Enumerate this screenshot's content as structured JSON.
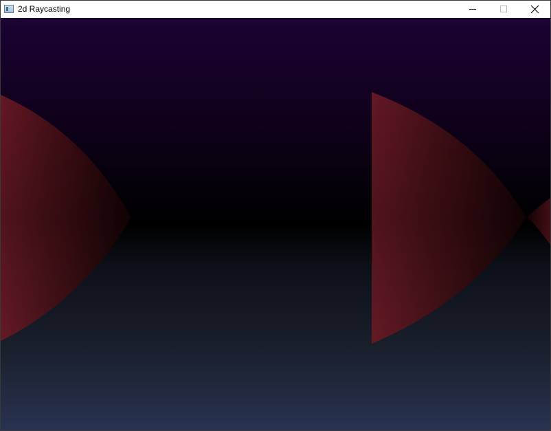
{
  "window": {
    "title": "2d Raycasting"
  },
  "icons": {
    "app": "app-window-icon",
    "minimize": "minimize-icon",
    "maximize": "maximize-icon",
    "close": "close-icon"
  },
  "colors": {
    "sky_top": "#1c0333",
    "horizon": "#000000",
    "floor_bottom": "#283350",
    "wall_near": "#6b1a24",
    "wall_far": "#150304"
  }
}
